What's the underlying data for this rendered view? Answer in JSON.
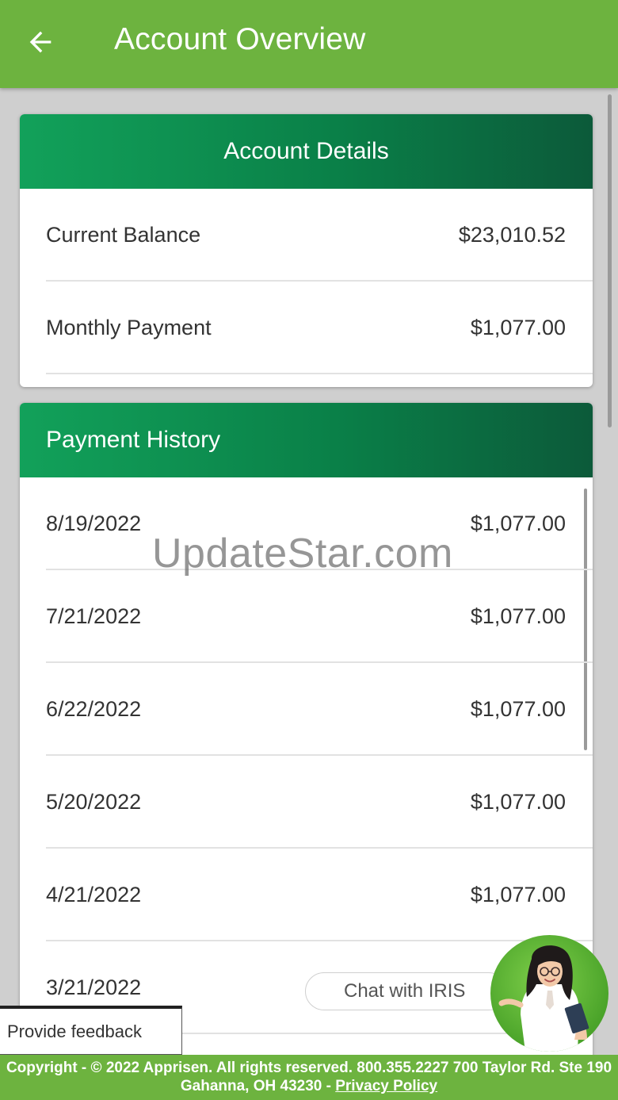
{
  "header": {
    "title": "Account Overview",
    "back_icon": "arrow-left-icon"
  },
  "account_details": {
    "title": "Account Details",
    "rows": [
      {
        "label": "Current Balance",
        "value": "$23,010.52"
      },
      {
        "label": "Monthly Payment",
        "value": "$1,077.00"
      }
    ]
  },
  "payment_history": {
    "title": "Payment History",
    "rows": [
      {
        "date": "8/19/2022",
        "amount": "$1,077.00"
      },
      {
        "date": "7/21/2022",
        "amount": "$1,077.00"
      },
      {
        "date": "6/22/2022",
        "amount": "$1,077.00"
      },
      {
        "date": "5/20/2022",
        "amount": "$1,077.00"
      },
      {
        "date": "4/21/2022",
        "amount": "$1,077.00"
      },
      {
        "date": "3/21/2022",
        "amount": ""
      }
    ]
  },
  "watermark": "UpdateStar.com",
  "chat": {
    "label": "Chat with IRIS",
    "avatar_icon": "iris-assistant-avatar-icon"
  },
  "feedback": {
    "label": "Provide feedback"
  },
  "footer": {
    "text": "Copyright - © 2022 Apprisen. All rights reserved. 800.355.2227 700 Taylor Rd. Ste 190 Gahanna, OH 43230 - ",
    "link": "Privacy Policy"
  },
  "colors": {
    "brand_green": "#6db33f",
    "header_gradient_start": "#12a15a",
    "header_gradient_end": "#0c5a3a",
    "background": "#cfcfcf"
  }
}
